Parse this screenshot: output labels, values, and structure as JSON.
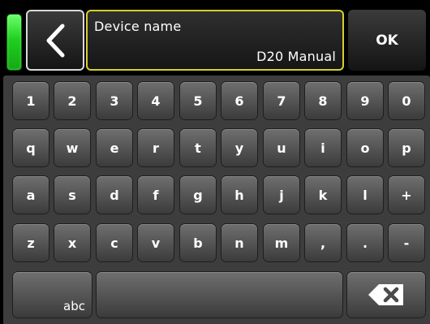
{
  "header": {
    "back_icon": "chevron-left-icon",
    "field": {
      "label": "Device name",
      "value": "D20 Manual"
    },
    "ok_label": "OK",
    "status_color": "#1fcf1f",
    "field_border_color": "#d6cf2d"
  },
  "keyboard": {
    "rows": [
      [
        "1",
        "2",
        "3",
        "4",
        "5",
        "6",
        "7",
        "8",
        "9",
        "0"
      ],
      [
        "q",
        "w",
        "e",
        "r",
        "t",
        "y",
        "u",
        "i",
        "o",
        "p"
      ],
      [
        "a",
        "s",
        "d",
        "f",
        "g",
        "h",
        "j",
        "k",
        "l",
        "+"
      ],
      [
        "z",
        "x",
        "c",
        "v",
        "b",
        "n",
        "m",
        ",",
        ".",
        "-"
      ]
    ],
    "mode_label": "abc",
    "space_label": "",
    "backspace_icon": "backspace-icon"
  }
}
